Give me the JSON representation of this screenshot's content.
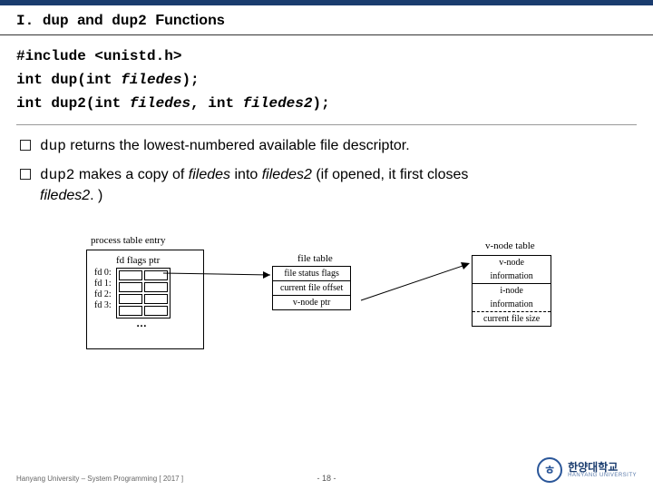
{
  "section": {
    "num": "I.",
    "code": "dup",
    "mid": "and",
    "code2": "dup2",
    "tail": "Functions"
  },
  "api": {
    "include": "#include <unistd.h>",
    "dup_pre": "int dup(int ",
    "dup_arg": "filedes",
    "dup_post": ");",
    "dup2_pre": "int dup2(int ",
    "dup2_arg1": "filedes",
    "dup2_mid": ", int ",
    "dup2_arg2": "filedes2",
    "dup2_post": ");"
  },
  "bullets": {
    "b1_code": "dup",
    "b1_text": " returns the lowest-numbered available file descriptor.",
    "b2_code": "dup2",
    "b2_t1": " makes a copy of ",
    "b2_i1": "filedes",
    "b2_t2": " into ",
    "b2_i2": "filedes2",
    "b2_t3": " (if opened, it first closes",
    "b2_i3": "filedes2",
    "b2_t4": ". )"
  },
  "diagram": {
    "proc_title": "process table entry",
    "fdhead": "fd flags  ptr",
    "row0": "fd 0:",
    "row1": "fd 1:",
    "row2": "fd 2:",
    "row3": "fd 3:",
    "dots": "…",
    "file_title": "file table",
    "file_rows": [
      "file status flags",
      "current file offset",
      "v-node ptr"
    ],
    "vnode_title": "v-node table",
    "vnode_rows": [
      "v-node",
      "information",
      "i-node",
      "information",
      "current file size"
    ]
  },
  "footer": "Hanyang University – System Programming  [ 2017 ]",
  "page": "- 18 -",
  "logo": {
    "ko": "한양대학교",
    "en": "HANYANG UNIVERSITY"
  }
}
